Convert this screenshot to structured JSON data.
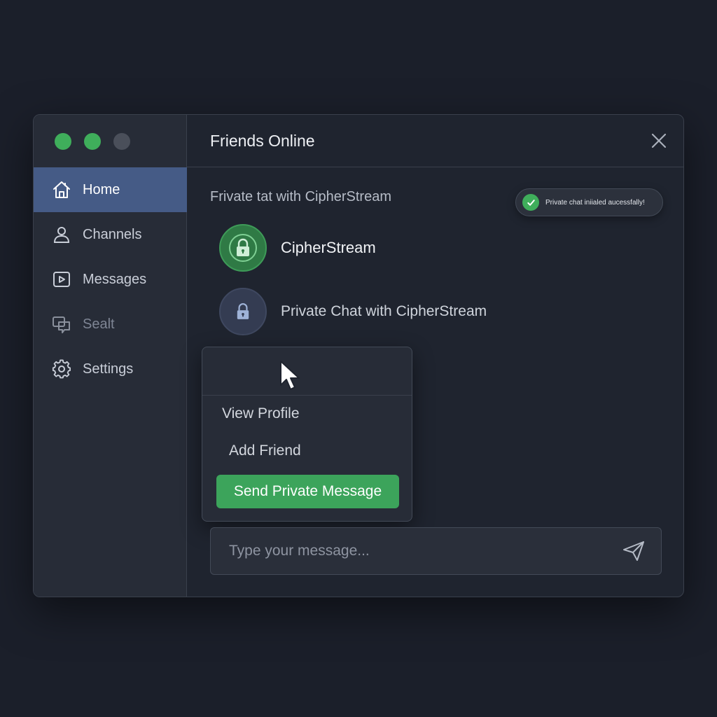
{
  "colors": {
    "traffic_1": "#3fae5b",
    "traffic_2": "#3fae5b",
    "traffic_3": "#4a4f5a",
    "accent_green": "#3ca45b",
    "active_nav": "#455b86"
  },
  "sidebar": {
    "items": [
      {
        "label": "Home",
        "icon": "home-icon"
      },
      {
        "label": "Channels",
        "icon": "user-icon"
      },
      {
        "label": "Messages",
        "icon": "video-message-icon"
      },
      {
        "label": "Sealt",
        "icon": "chat-bubbles-icon"
      },
      {
        "label": "Settings",
        "icon": "gear-icon"
      }
    ]
  },
  "header": {
    "title": "Friends Online",
    "close_icon": "close-icon"
  },
  "chat": {
    "subtitle": "Frivate tat with CipherStream"
  },
  "toast": {
    "text": "Private chat iniialed aucessfally!",
    "icon": "check-icon"
  },
  "friends": [
    {
      "name": "CipherStream",
      "icon": "lock-icon"
    },
    {
      "name": "Private Chat with CipherStream",
      "icon": "lock-icon"
    }
  ],
  "context_menu": {
    "view_profile": "View Profile",
    "add_friend": "Add Friend",
    "send_private": "Send Private Message"
  },
  "composer": {
    "placeholder": "Type your message...",
    "send_icon": "send-icon"
  }
}
